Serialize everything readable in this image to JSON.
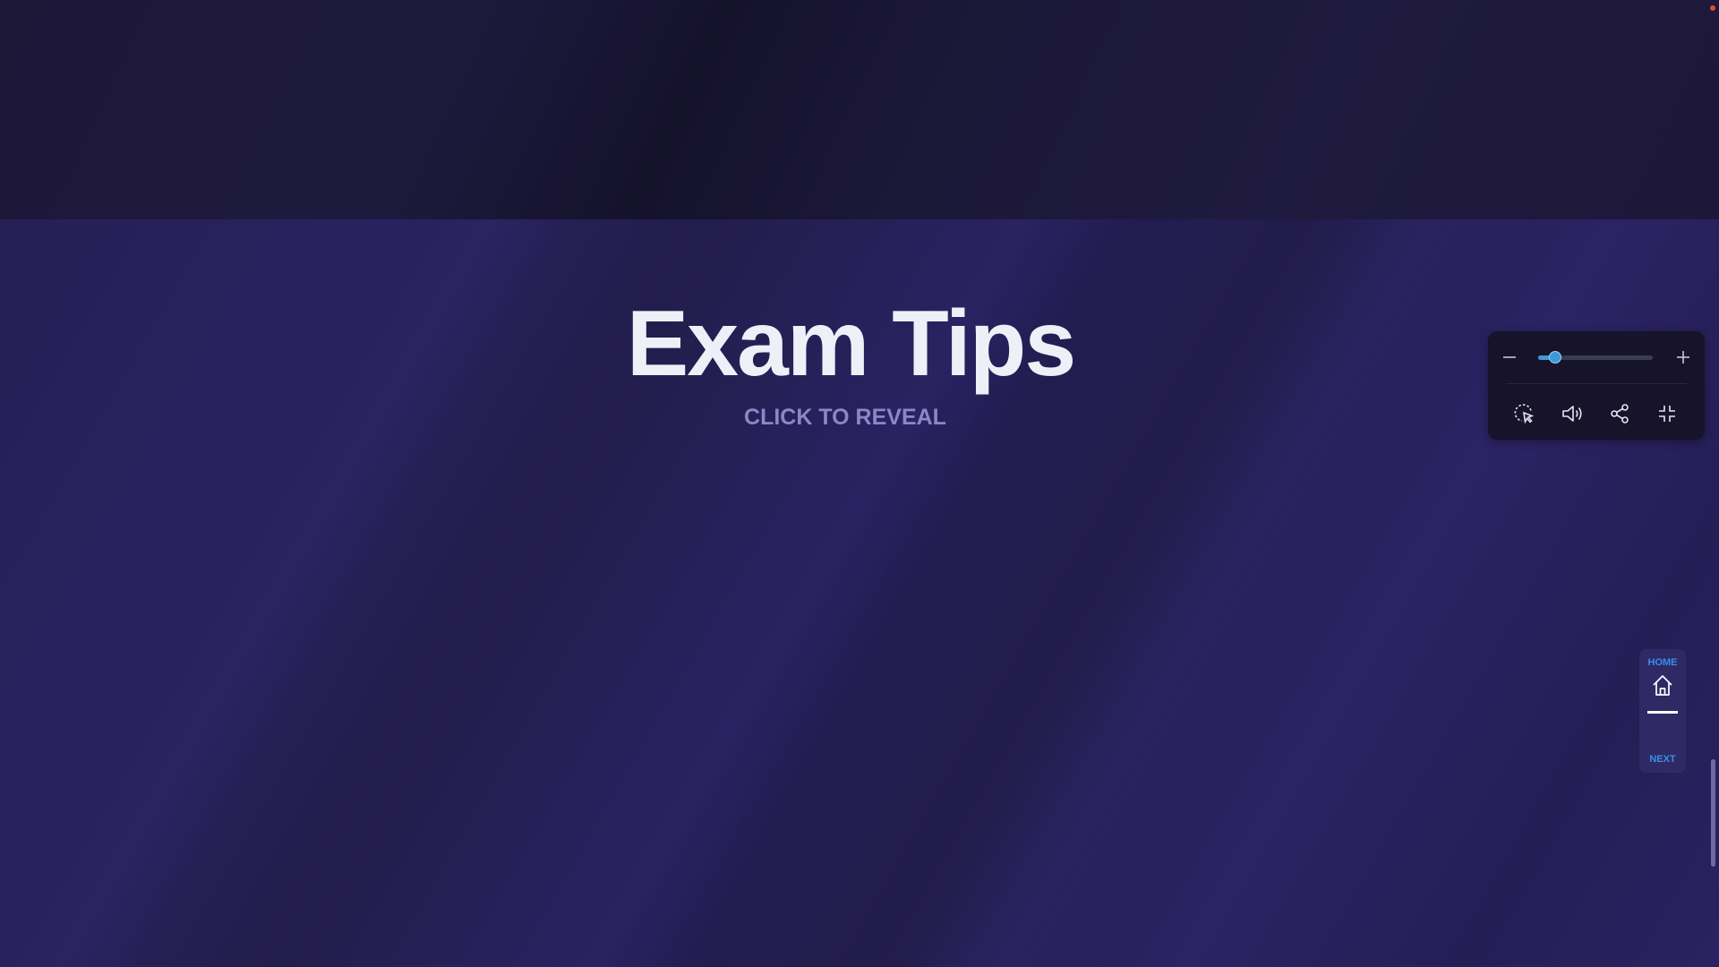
{
  "page": {
    "title": "Exam Tips",
    "reveal_label": "CLICK TO REVEAL"
  },
  "controls": {
    "zoom_level": 0.15,
    "icons": {
      "zoom_out": "minus-icon",
      "zoom_in": "plus-icon",
      "pointer": "click-pointer-icon",
      "audio": "speaker-icon",
      "share": "share-icon",
      "exit_fullscreen": "minimize-icon"
    },
    "accent_color": "#3d9ad6"
  },
  "nav": {
    "home_label": "HOME",
    "next_label": "NEXT",
    "home_icon": "home-icon",
    "label_color": "#3b8ee8"
  },
  "colors": {
    "background": "#251f54",
    "title": "#eef0f8",
    "reveal": "#8d86c7"
  }
}
